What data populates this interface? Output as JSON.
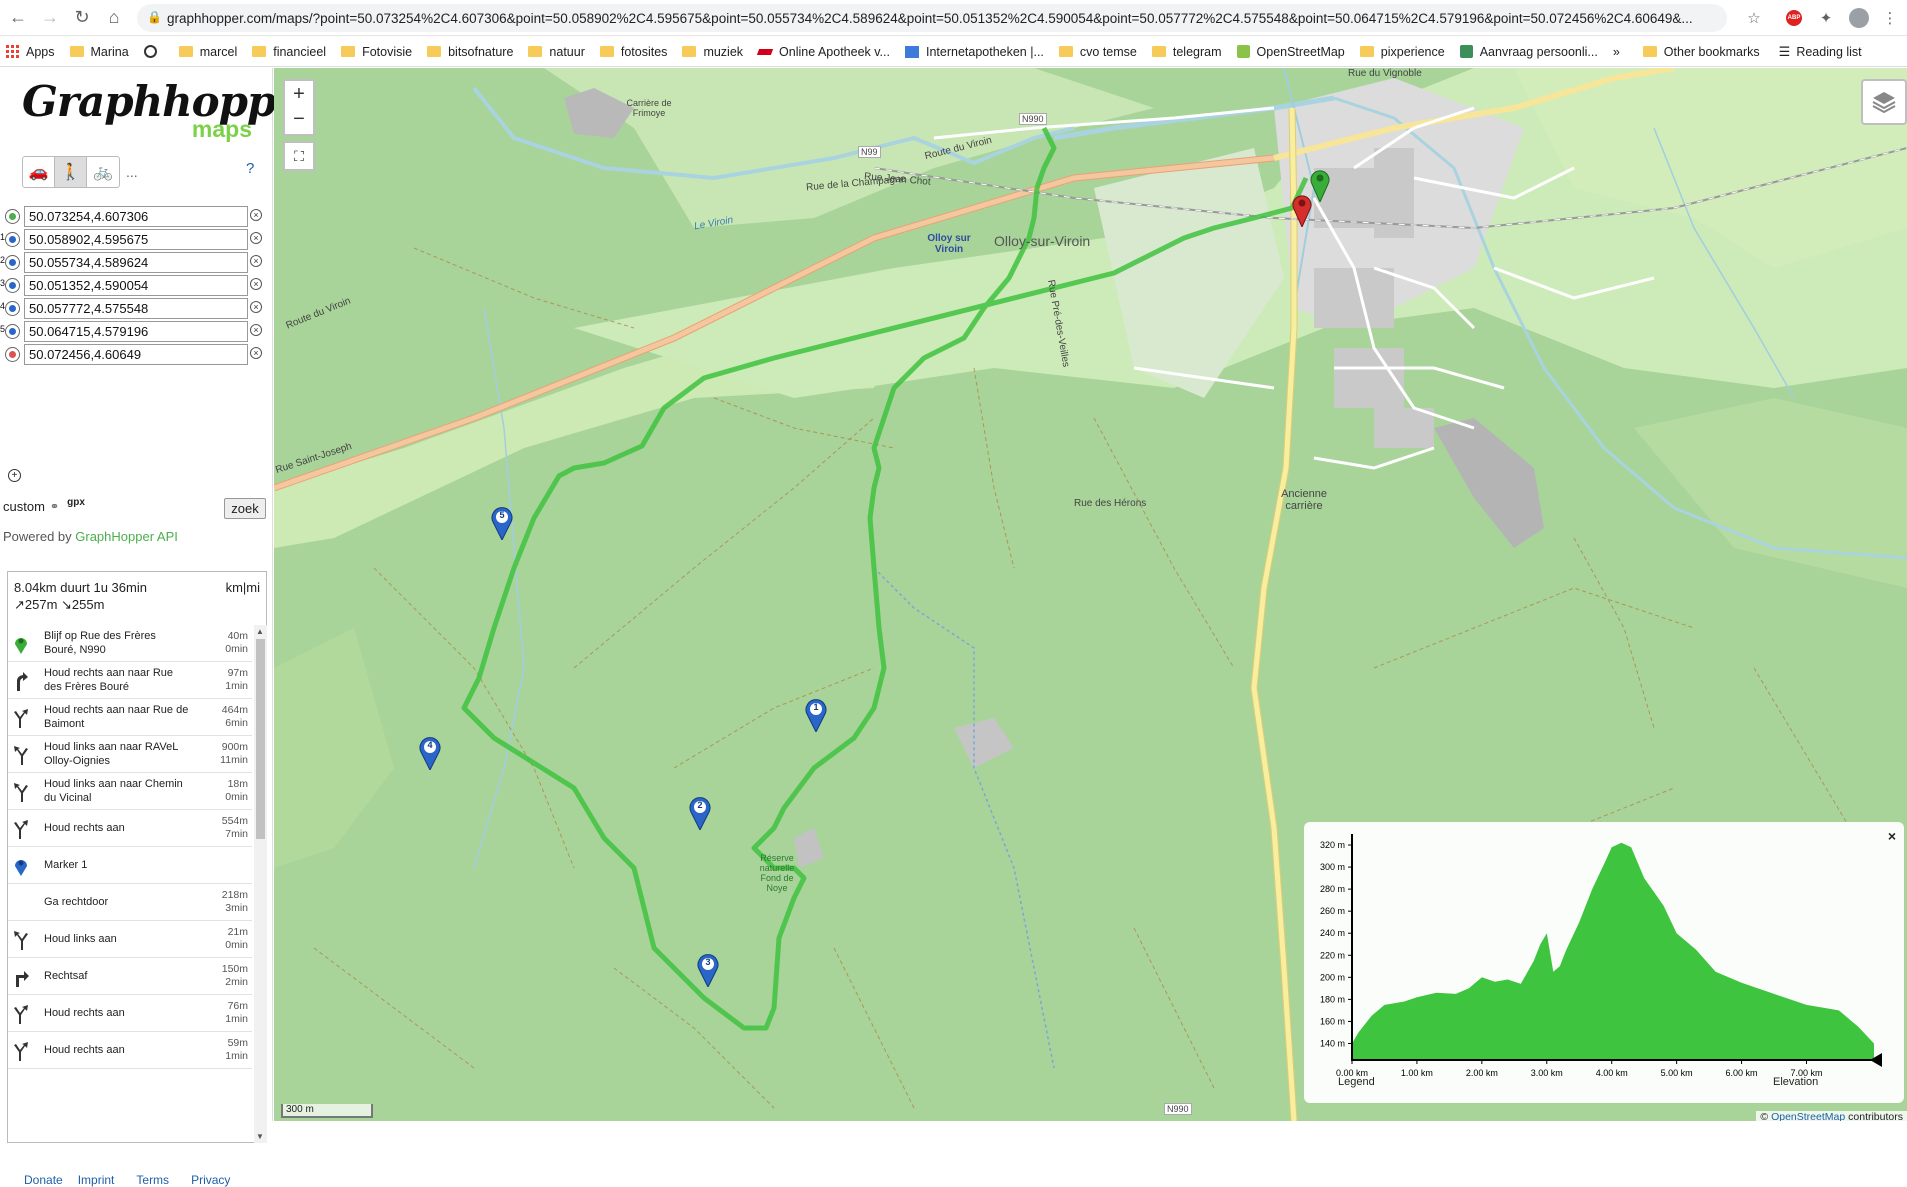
{
  "browser": {
    "url": "graphhopper.com/maps/?point=50.073254%2C4.607306&point=50.058902%2C4.595675&point=50.055734%2C4.589624&point=50.051352%2C4.590054&point=50.057772%2C4.575548&point=50.064715%2C4.579196&point=50.072456%2C4.60649&...",
    "bookmarks": [
      "Apps",
      "Marina",
      "marcel",
      "financieel",
      "Fotovisie",
      "bitsofnature",
      "natuur",
      "fotosites",
      "muziek",
      "Online Apotheek v...",
      "Internetapotheken |...",
      "cvo temse",
      "telegram",
      "OpenStreetMap",
      "pixperience",
      "Aanvraag persoonli...",
      "»",
      "Other bookmarks",
      "Reading list"
    ]
  },
  "sidebar": {
    "logo": {
      "wordmark": "Graphhopper",
      "sub": "maps"
    },
    "help": "?",
    "more": "...",
    "points": [
      {
        "num": "",
        "value": "50.073254,4.607306",
        "color": "#4cae4c"
      },
      {
        "num": "1",
        "value": "50.058902,4.595675",
        "color": "#2a66c8"
      },
      {
        "num": "2",
        "value": "50.055734,4.589624",
        "color": "#2a66c8"
      },
      {
        "num": "3",
        "value": "50.051352,4.590054",
        "color": "#2a66c8"
      },
      {
        "num": "4",
        "value": "50.057772,4.575548",
        "color": "#2a66c8"
      },
      {
        "num": "5",
        "value": "50.064715,4.579196",
        "color": "#2a66c8"
      },
      {
        "num": "",
        "value": "50.072456,4.60649",
        "color": "#d9534f"
      }
    ],
    "custom": "custom",
    "gpx": "gpx",
    "search": "zoek",
    "powered_prefix": "Powered by ",
    "powered_link": "GraphHopper API",
    "summary": "8.04km duurt 1u 36min",
    "ascend": "↗257m ↘255m",
    "units": "km|mi",
    "instructions": [
      {
        "icon": "green-pin",
        "text": "Blijf op Rue des Frères Bouré, N990",
        "dist": "40m",
        "time": "0min"
      },
      {
        "icon": "turn-slight-right",
        "text": "Houd rechts aan naar Rue des Frères Bouré",
        "dist": "97m",
        "time": "1min"
      },
      {
        "icon": "keep-right",
        "text": "Houd rechts aan naar Rue de Baimont",
        "dist": "464m",
        "time": "6min"
      },
      {
        "icon": "keep-left",
        "text": "Houd links aan naar RAVeL Olloy-Oignies",
        "dist": "900m",
        "time": "11min"
      },
      {
        "icon": "keep-left",
        "text": "Houd links aan naar Chemin du Vicinal",
        "dist": "18m",
        "time": "0min"
      },
      {
        "icon": "keep-right",
        "text": "Houd rechts aan",
        "dist": "554m",
        "time": "7min"
      },
      {
        "icon": "blue-pin",
        "text": "Marker 1",
        "dist": "",
        "time": ""
      },
      {
        "icon": "none",
        "text": "Ga rechtdoor",
        "dist": "218m",
        "time": "3min"
      },
      {
        "icon": "keep-left",
        "text": "Houd links aan",
        "dist": "21m",
        "time": "0min"
      },
      {
        "icon": "turn-right",
        "text": "Rechtsaf",
        "dist": "150m",
        "time": "2min"
      },
      {
        "icon": "keep-right",
        "text": "Houd rechts aan",
        "dist": "76m",
        "time": "1min"
      },
      {
        "icon": "keep-right",
        "text": "Houd rechts aan",
        "dist": "59m",
        "time": "1min"
      }
    ],
    "footer": [
      "Donate",
      "Imprint",
      "Terms",
      "Privacy"
    ]
  },
  "map": {
    "zoom_in": "+",
    "zoom_out": "−",
    "scale": "300 m",
    "attribution_prefix": "© ",
    "attribution_link": "OpenStreetMap",
    "attribution_suffix": " contributors",
    "labels": [
      {
        "text": "Rue du Vignoble"
      },
      {
        "text": "N990"
      },
      {
        "text": "Route du Viroin"
      },
      {
        "text": "N99"
      },
      {
        "text": "Rue Jean Chot"
      },
      {
        "text": "Rue de la Champagne"
      },
      {
        "text": "Le Viroin"
      },
      {
        "text": "Olloy sur Viroin"
      },
      {
        "text": "Olloy-sur-Viroin"
      },
      {
        "text": "Route du Viroin"
      },
      {
        "text": "Rue Saint-Joseph"
      },
      {
        "text": "Rue Pré-des-Veilles"
      },
      {
        "text": "Rue des Hérons"
      },
      {
        "text": "Ancienne carrière"
      },
      {
        "text": "Carrière de Frimoye"
      },
      {
        "text": "Réserve naturelle Fond de Noye"
      },
      {
        "text": "N990"
      }
    ],
    "markers": [
      "1",
      "2",
      "3",
      "4",
      "5"
    ],
    "route_color": "#3fc23f"
  },
  "elevation": {
    "legend": "Legend",
    "title": "Elevation",
    "close": "×",
    "y_ticks": [
      "320 m",
      "300 m",
      "280 m",
      "260 m",
      "240 m",
      "220 m",
      "200 m",
      "180 m",
      "160 m",
      "140 m"
    ],
    "x_ticks": [
      "0.00 km",
      "1.00 km",
      "2.00 km",
      "3.00 km",
      "4.00 km",
      "5.00 km",
      "6.00 km",
      "7.00 km"
    ],
    "fill_color": "#3ec43e",
    "chart_data": {
      "type": "area",
      "xlabel": "",
      "ylabel": "",
      "ylim": [
        125,
        330
      ],
      "xlim": [
        0,
        8.04
      ],
      "x": [
        0,
        0.1,
        0.3,
        0.5,
        0.8,
        1.0,
        1.3,
        1.6,
        1.8,
        2.0,
        2.2,
        2.4,
        2.6,
        2.8,
        2.9,
        3.0,
        3.1,
        3.2,
        3.3,
        3.5,
        3.7,
        3.9,
        4.0,
        4.15,
        4.3,
        4.5,
        4.8,
        5.0,
        5.3,
        5.6,
        6.0,
        6.5,
        7.0,
        7.5,
        7.8,
        8.04
      ],
      "y": [
        140,
        150,
        165,
        175,
        178,
        182,
        186,
        185,
        190,
        200,
        196,
        198,
        194,
        215,
        230,
        240,
        205,
        210,
        225,
        250,
        280,
        305,
        318,
        322,
        318,
        290,
        265,
        240,
        225,
        205,
        195,
        185,
        175,
        170,
        155,
        140
      ]
    }
  }
}
